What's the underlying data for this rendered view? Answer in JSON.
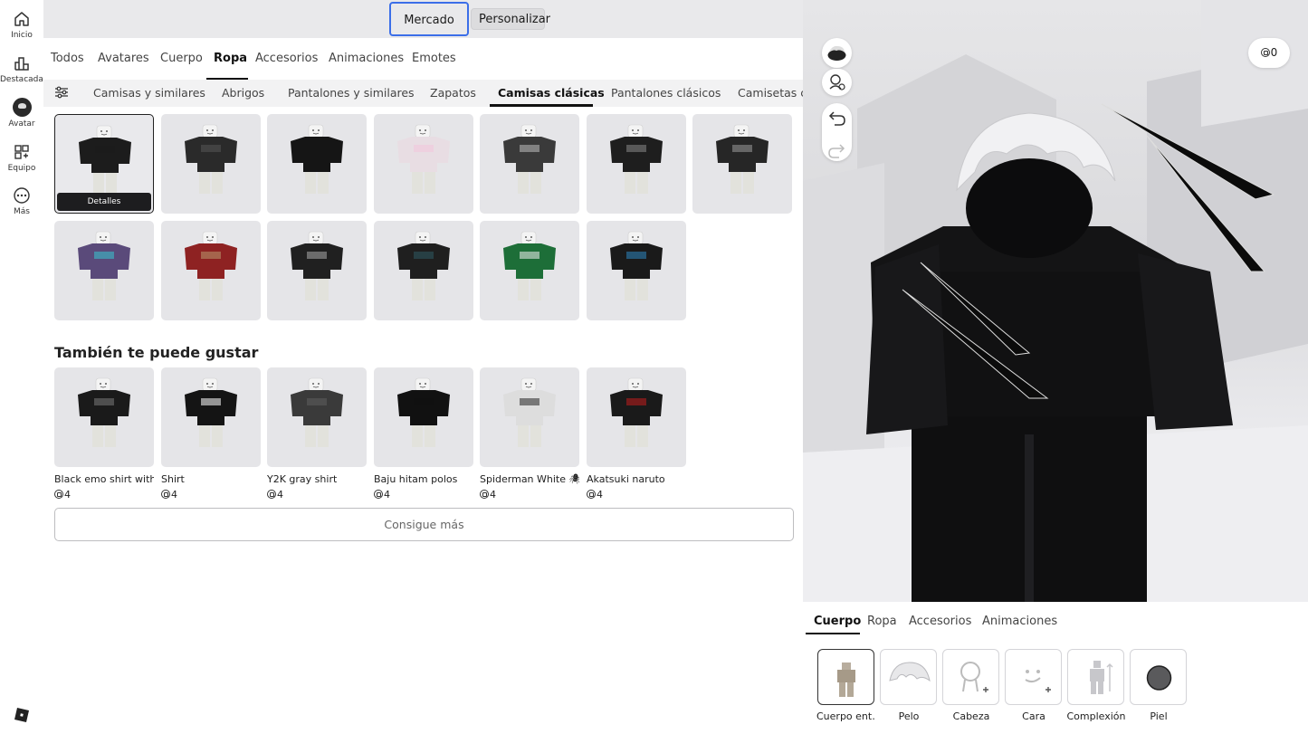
{
  "nav": {
    "items": [
      {
        "label": "Inicio",
        "icon": "home-icon"
      },
      {
        "label": "Destacadas",
        "icon": "chart-icon"
      },
      {
        "label": "Avatar",
        "icon": "avatar-icon"
      },
      {
        "label": "Equipo",
        "icon": "group-icon"
      },
      {
        "label": "Más",
        "icon": "more-icon"
      }
    ]
  },
  "header": {
    "market_label": "Mercado",
    "customize_label": "Personalizar"
  },
  "category_tabs": [
    "Todos",
    "Avatares",
    "Cuerpo",
    "Ropa",
    "Accesorios",
    "Animaciones",
    "Emotes"
  ],
  "active_category": "Ropa",
  "sub_tabs": [
    "Camisas y similares",
    "Abrigos",
    "Pantalones y similares",
    "Zapatos",
    "Camisas clásicas",
    "Pantalones clásicos",
    "Camisetas c"
  ],
  "active_sub_tab": "Camisas clásicas",
  "inventory": {
    "details_label": "Detalles",
    "items": [
      {
        "color": "#1c1c1c",
        "accent": "#1c1c1c"
      },
      {
        "color": "#2a2a2a",
        "accent": "#555555"
      },
      {
        "color": "#151515",
        "accent": "#151515"
      },
      {
        "color": "#e8dde3",
        "accent": "#f2c4dc"
      },
      {
        "color": "#3a3a3a",
        "accent": "#bdbdbd"
      },
      {
        "color": "#1e1e1e",
        "accent": "#888888"
      },
      {
        "color": "#262626",
        "accent": "#9a9a9a"
      },
      {
        "color": "#5a4a7a",
        "accent": "#39c6cf"
      },
      {
        "color": "#8e2222",
        "accent": "#b89a70"
      },
      {
        "color": "#202020",
        "accent": "#a9a9a9"
      },
      {
        "color": "#1f1f1f",
        "accent": "#2e5a63"
      },
      {
        "color": "#1d6e38",
        "accent": "#f0f0f0"
      },
      {
        "color": "#1a1a1a",
        "accent": "#2e86c1"
      }
    ]
  },
  "recommendations": {
    "title": "También te puede gustar",
    "items": [
      {
        "name": "Black emo shirt with",
        "price": "4",
        "color": "#1a1a1a",
        "accent": "#7a7a7a"
      },
      {
        "name": "Shirt",
        "price": "4",
        "color": "#141414",
        "accent": "#ffffff"
      },
      {
        "name": "Y2K gray shirt",
        "price": "4",
        "color": "#3a3a3a",
        "accent": "#5e5e5e"
      },
      {
        "name": "Baju hitam polos",
        "price": "4",
        "color": "#111111",
        "accent": "#111111"
      },
      {
        "name": "Spiderman White 🕷",
        "price": "4",
        "color": "#dddddd",
        "accent": "#222222"
      },
      {
        "name": "Akatsuki naruto",
        "price": "4",
        "color": "#1a1a1a",
        "accent": "#c21d1d"
      }
    ],
    "more_label": "Consigue más"
  },
  "viewport": {
    "robux_balance": "0"
  },
  "editor": {
    "tabs": [
      "Cuerpo",
      "Ropa",
      "Accesorios",
      "Animaciones"
    ],
    "active_tab": "Cuerpo",
    "slots": [
      {
        "label": "Cuerpo ent…"
      },
      {
        "label": "Pelo"
      },
      {
        "label": "Cabeza"
      },
      {
        "label": "Cara"
      },
      {
        "label": "Complexión"
      },
      {
        "label": "Piel"
      }
    ]
  },
  "colors": {
    "accent_blue": "#3b6ee8",
    "tile_bg": "#e5e5e8"
  }
}
